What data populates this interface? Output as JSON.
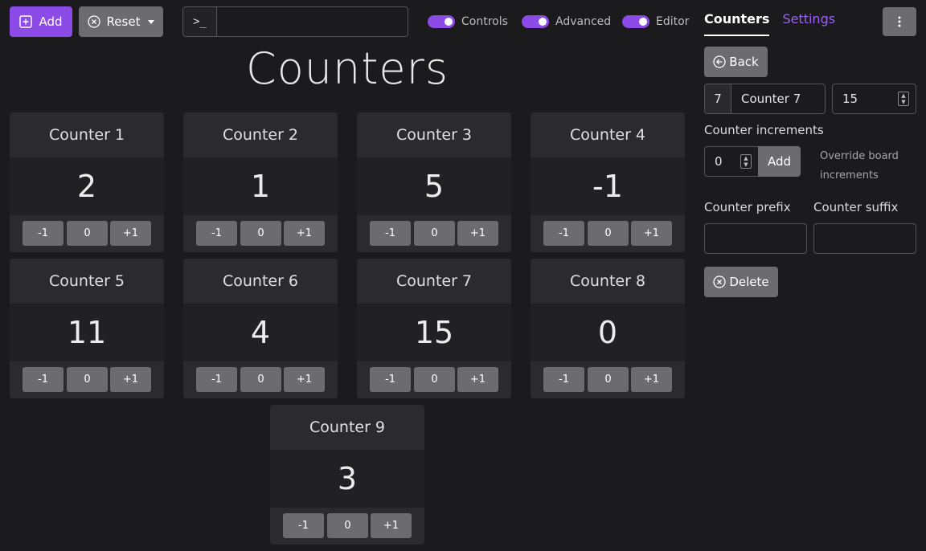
{
  "toolbar": {
    "add_label": "Add",
    "reset_label": "Reset",
    "command_prompt": ">_",
    "command_value": "",
    "toggles": [
      {
        "label": "Controls",
        "on": true
      },
      {
        "label": "Advanced",
        "on": true
      },
      {
        "label": "Editor",
        "on": true
      }
    ]
  },
  "page_title": "Counters",
  "counters": [
    {
      "name": "Counter 1",
      "value": "2"
    },
    {
      "name": "Counter 2",
      "value": "1"
    },
    {
      "name": "Counter 3",
      "value": "5"
    },
    {
      "name": "Counter 4",
      "value": "-1"
    },
    {
      "name": "Counter 5",
      "value": "11"
    },
    {
      "name": "Counter 6",
      "value": "4"
    },
    {
      "name": "Counter 7",
      "value": "15"
    },
    {
      "name": "Counter 8",
      "value": "0"
    },
    {
      "name": "Counter 9",
      "value": "3"
    }
  ],
  "counter_buttons": {
    "decrement": "-1",
    "reset": "0",
    "increment": "+1"
  },
  "sidebar": {
    "tabs": [
      {
        "label": "Counters",
        "active": true
      },
      {
        "label": "Settings",
        "active": false
      }
    ],
    "back_label": "Back",
    "selected_index": "7",
    "selected_name": "Counter 7",
    "selected_value": "15",
    "increments_label": "Counter increments",
    "increment_value": "0",
    "increment_add_label": "Add",
    "override_note": "Override board increments",
    "prefix_label": "Counter prefix",
    "prefix_value": "",
    "suffix_label": "Counter suffix",
    "suffix_value": "",
    "delete_label": "Delete"
  },
  "colors": {
    "accent": "#8c4be6",
    "button_grey": "#6c6c70",
    "background": "#1b1b1d",
    "link": "#9a63f0"
  }
}
